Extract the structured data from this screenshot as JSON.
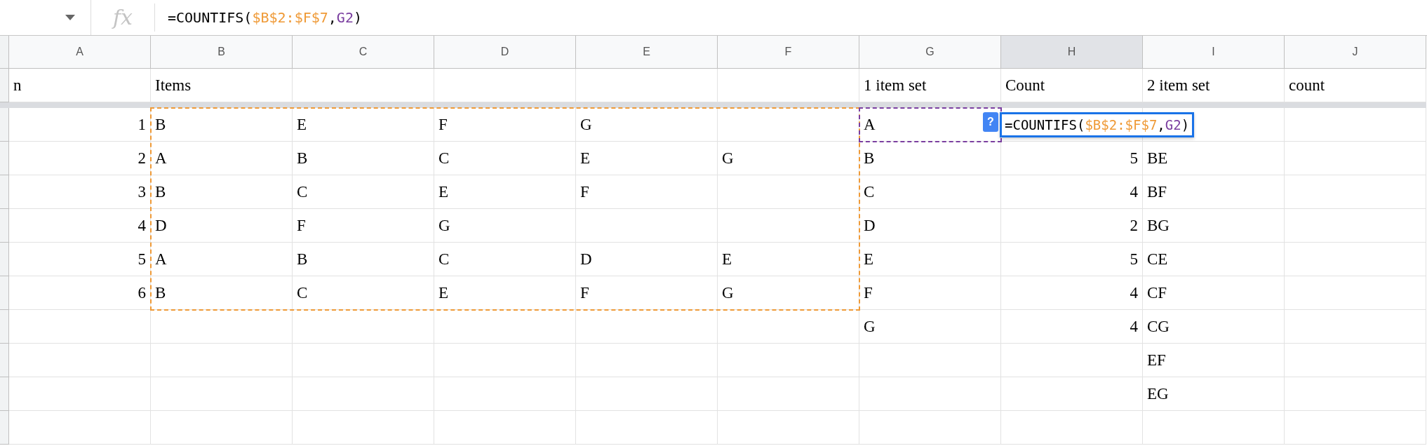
{
  "formula_bar": {
    "fx_label": "fx",
    "segments": [
      {
        "kind": "text",
        "text": "=COUNTIFS("
      },
      {
        "kind": "ref",
        "text": "$B$2:$F$7",
        "color": "#ef9a37"
      },
      {
        "kind": "text",
        "text": ","
      },
      {
        "kind": "ref",
        "text": "G2",
        "color": "#7b3fa0"
      },
      {
        "kind": "text",
        "text": ")"
      }
    ]
  },
  "columns": [
    {
      "label": "A",
      "selected": false
    },
    {
      "label": "B",
      "selected": false
    },
    {
      "label": "C",
      "selected": false
    },
    {
      "label": "D",
      "selected": false
    },
    {
      "label": "E",
      "selected": false
    },
    {
      "label": "F",
      "selected": false
    },
    {
      "label": "G",
      "selected": false
    },
    {
      "label": "H",
      "selected": true
    },
    {
      "label": "I",
      "selected": false
    },
    {
      "label": "J",
      "selected": false
    }
  ],
  "header_row": {
    "A": "n",
    "B": "Items",
    "G": "1 item set",
    "H": "Count",
    "I": "2 item set",
    "J": "count"
  },
  "rows": [
    {
      "A": "1",
      "B": "B",
      "C": "E",
      "D": "F",
      "E": "G",
      "G": "A"
    },
    {
      "A": "2",
      "B": "A",
      "C": "B",
      "D": "C",
      "E": "E",
      "F": "G",
      "G": "B",
      "H": "5",
      "I": "BE"
    },
    {
      "A": "3",
      "B": "B",
      "C": "C",
      "D": "E",
      "E": "F",
      "G": "C",
      "H": "4",
      "I": "BF"
    },
    {
      "A": "4",
      "B": "D",
      "C": "F",
      "D": "G",
      "G": "D",
      "H": "2",
      "I": "BG"
    },
    {
      "A": "5",
      "B": "A",
      "C": "B",
      "D": "C",
      "E": "D",
      "F": "E",
      "G": "E",
      "H": "5",
      "I": "CE"
    },
    {
      "A": "6",
      "B": "B",
      "C": "C",
      "D": "E",
      "E": "F",
      "F": "G",
      "G": "F",
      "H": "4",
      "I": "CF"
    },
    {
      "G": "G",
      "H": "4",
      "I": "CG"
    },
    {
      "I": "EF"
    },
    {
      "I": "EG"
    }
  ],
  "editor": {
    "help": "?",
    "segments": [
      {
        "kind": "text",
        "text": "=COUNTIFS("
      },
      {
        "kind": "ref",
        "text": "$B$2:$F$7",
        "color": "#ef9a37"
      },
      {
        "kind": "text",
        "text": ","
      },
      {
        "kind": "ref",
        "text": "G2",
        "color": "#7b3fa0"
      },
      {
        "kind": "text",
        "text": ")"
      }
    ]
  }
}
